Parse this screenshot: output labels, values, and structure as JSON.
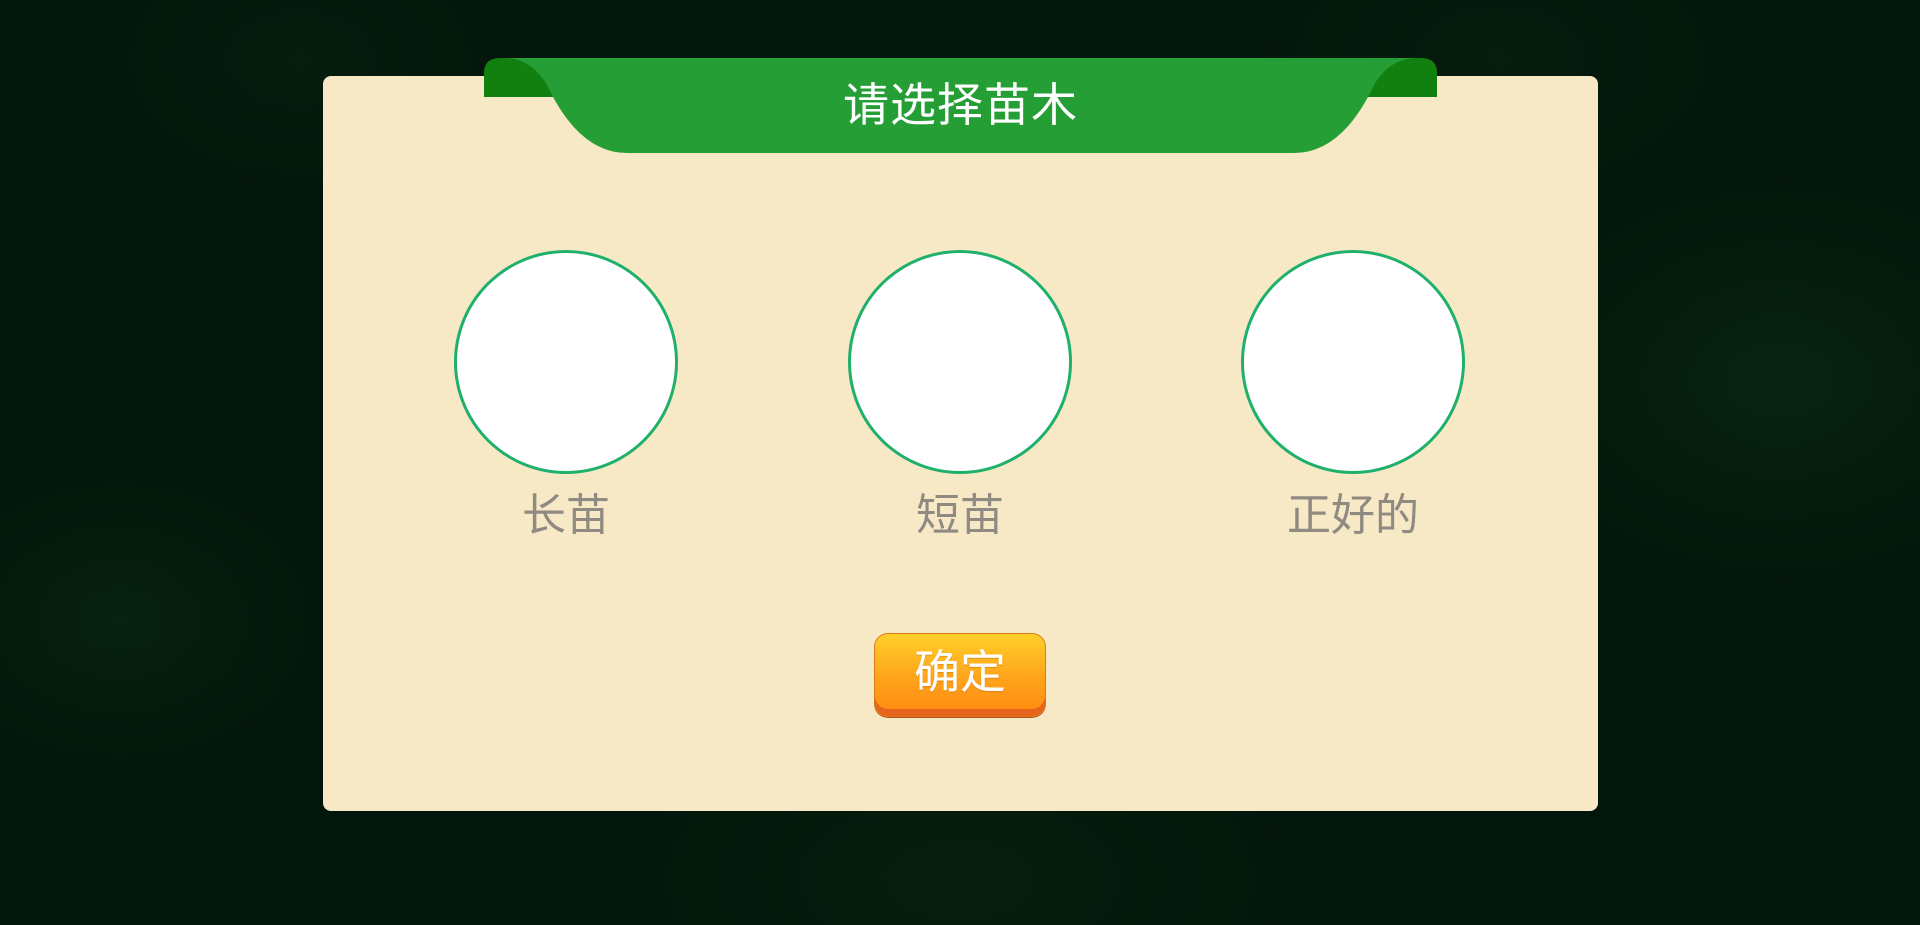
{
  "dialog": {
    "title": "请选择苗木",
    "options": [
      {
        "label": "长苗"
      },
      {
        "label": "短苗"
      },
      {
        "label": "正好的"
      }
    ],
    "confirm_label": "确定"
  },
  "colors": {
    "background": "#03160b",
    "dialog_background": "#f8e9c6",
    "banner_green": "#259e36",
    "banner_dark_green": "#12800f",
    "circle_border": "#1fb06c",
    "label_gray": "#8f8a82",
    "button_orange": "#ffa31a"
  }
}
